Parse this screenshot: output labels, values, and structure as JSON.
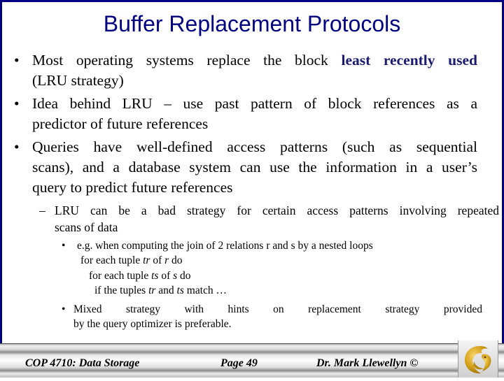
{
  "slide": {
    "title": "Buffer Replacement Protocols",
    "bullets": [
      {
        "line1_pre": "Most operating systems replace the block ",
        "line1_emph": "least recently used",
        "line2": "(LRU strategy)"
      },
      {
        "line1": "Idea behind LRU – use past pattern of block references as a",
        "line2": "predictor of future references"
      },
      {
        "line1": "Queries have well-defined access patterns (such as sequential",
        "line2": "scans), and a database system can use the information in a user’s",
        "line3": "query to predict future references"
      }
    ],
    "sub_bullet": {
      "marker": "–",
      "line1": "LRU can be a bad strategy for certain access patterns involving repeated",
      "line2": "scans of data"
    },
    "sub_sub_bullets": [
      {
        "marker": "•",
        "line1": "e.g. when computing the join of 2 relations r and s by a nested loops",
        "code": [
          {
            "pre": "for each tuple ",
            "v1": "tr",
            "mid": " of ",
            "v2": "r",
            "post": " do"
          },
          {
            "pre": "for each tuple ",
            "v1": "ts",
            "mid": " of ",
            "v2": "s",
            "post": " do"
          },
          {
            "pre": "if the tuples ",
            "v1": "tr",
            "mid": " and ",
            "v2": "ts",
            "post": " match …"
          }
        ]
      },
      {
        "marker": "•",
        "line1": "Mixed strategy with hints on replacement strategy provided",
        "line2": "by the query optimizer is preferable."
      }
    ],
    "bullet_marker": "•"
  },
  "footer": {
    "course": "COP 4710: Data Storage",
    "page": "Page 49",
    "author": "Dr. Mark Llewellyn ©",
    "logo": "ucf-pegasus-logo"
  },
  "colors": {
    "title": "#000080",
    "frame": "#000080",
    "emphasis": "#1a1a6e",
    "logo_gold": "#d4a017"
  }
}
